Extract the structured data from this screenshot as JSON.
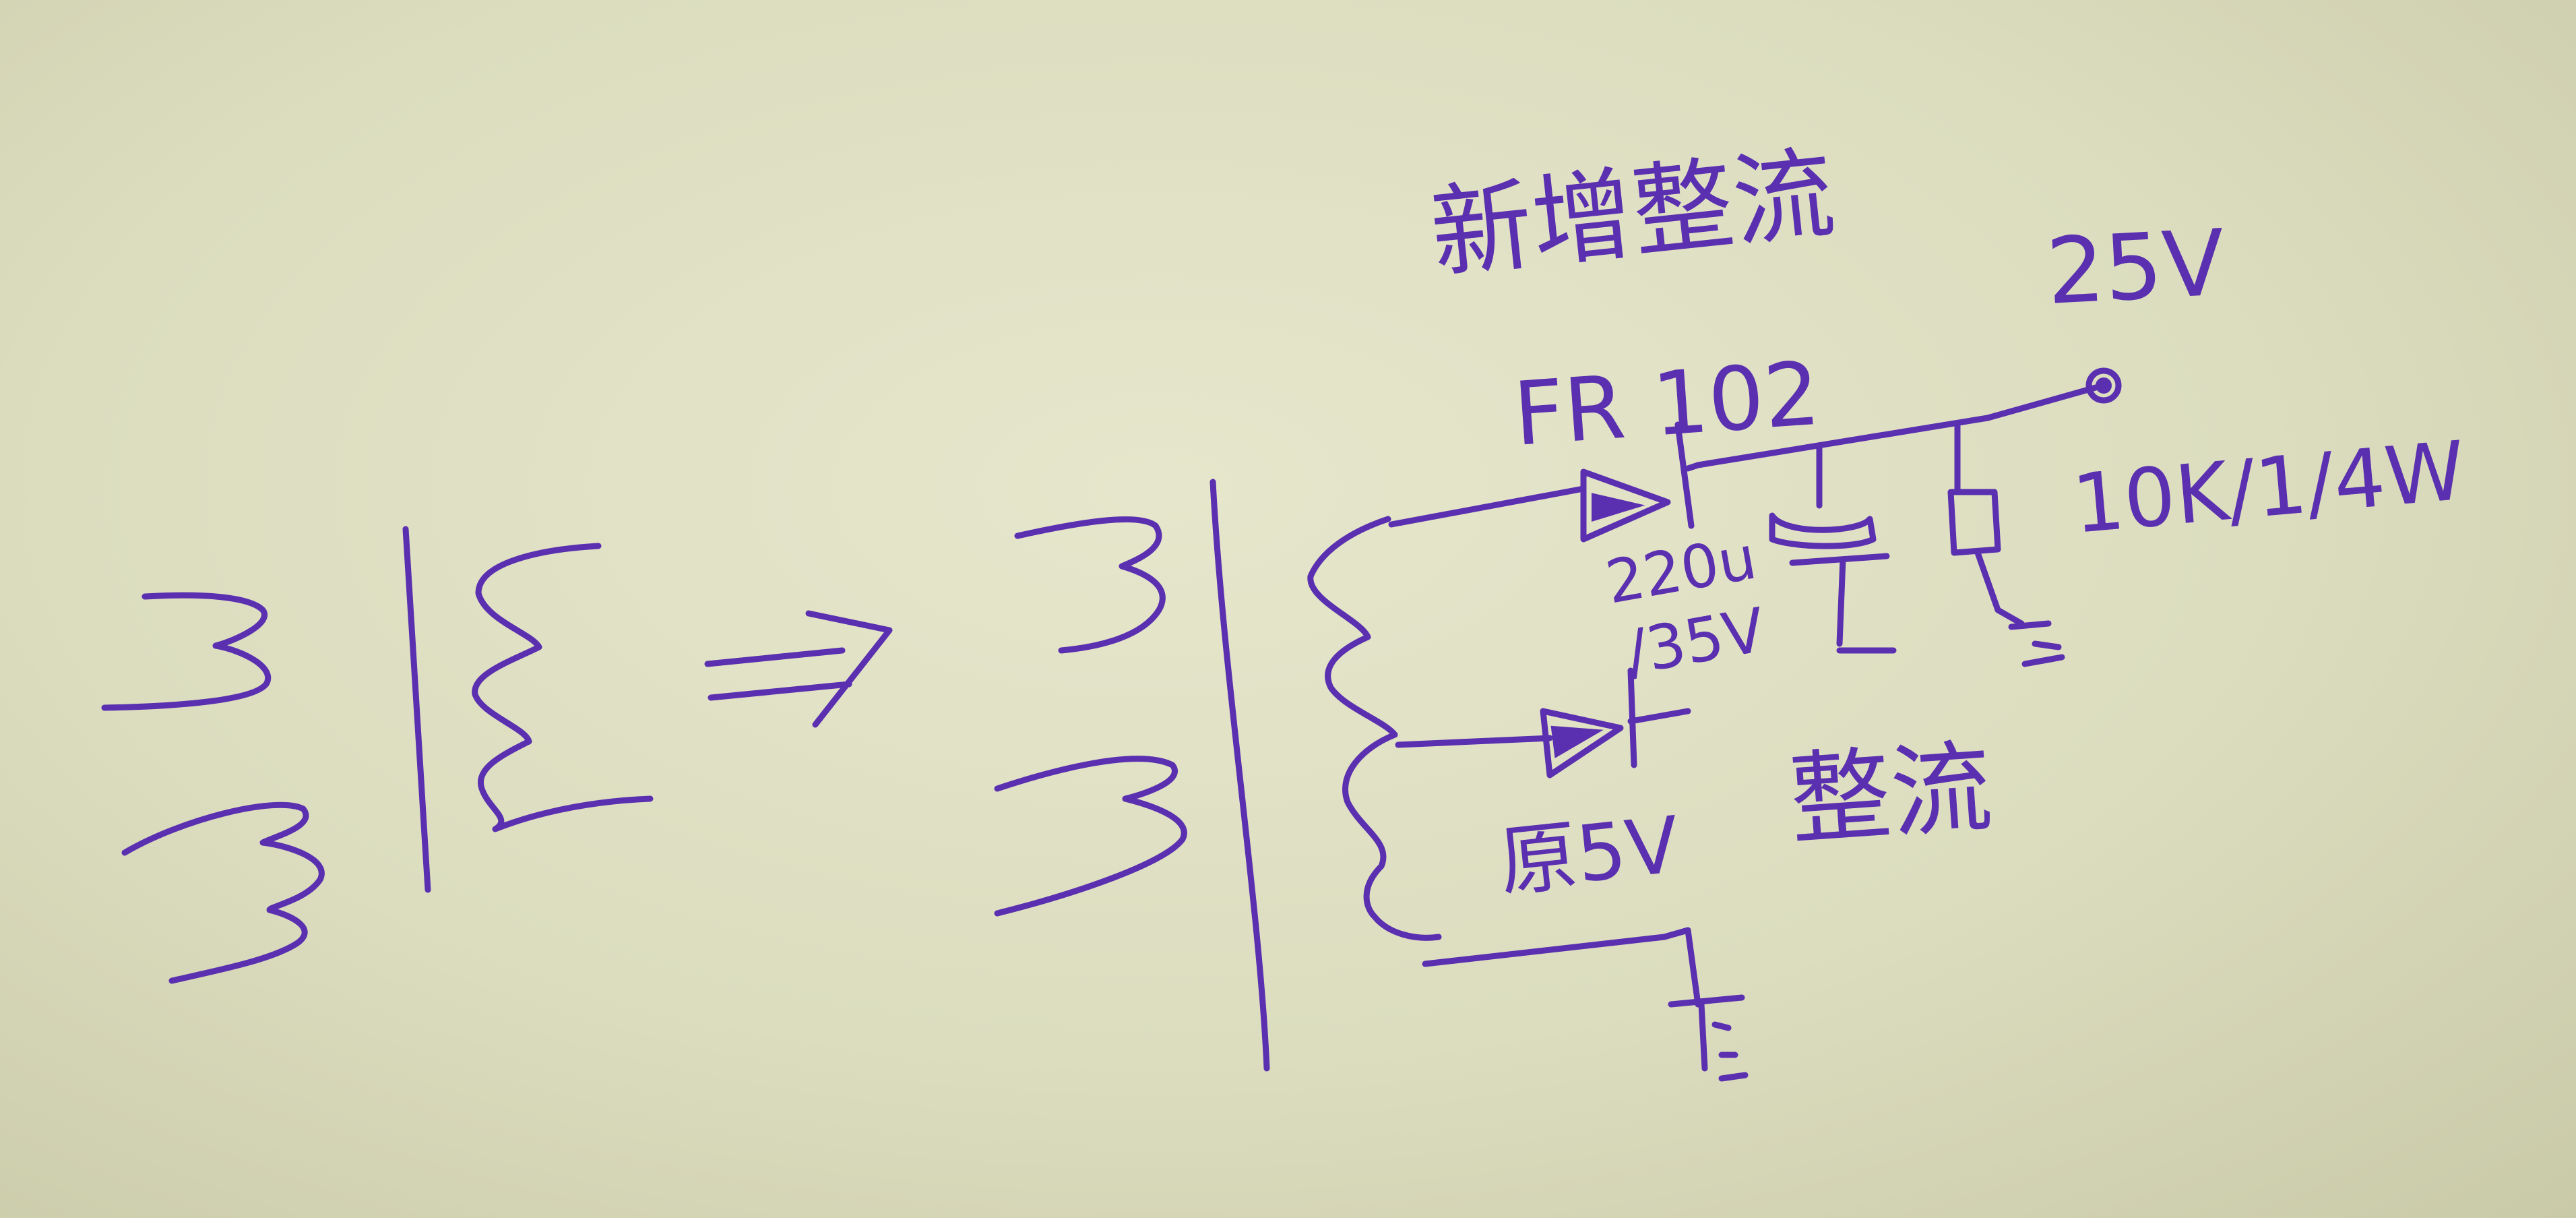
{
  "annotations": {
    "title_cn": "新增整流",
    "diode_part": "FR 102",
    "output_voltage": "25V",
    "resistor_spec": "10K/1/4W",
    "cap_value": "220u",
    "cap_voltage": "/35V",
    "rectify_cn": "整流",
    "original_5v": "原5V",
    "arrow": "⇒"
  },
  "colors": {
    "ink": "#5a2fb0",
    "paper": "#e2e3c6"
  }
}
